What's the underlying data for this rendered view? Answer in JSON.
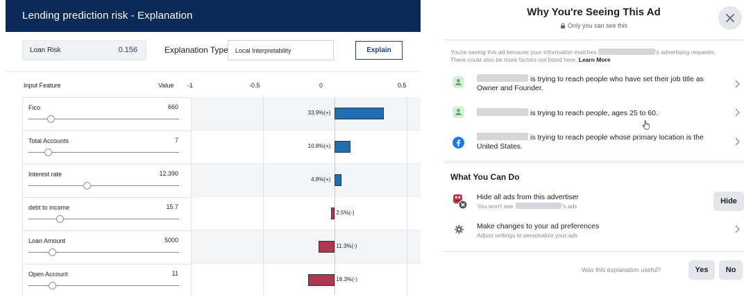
{
  "left_panel": {
    "title": "Lending prediction risk - Explanation",
    "loan_risk_label": "Loan Risk",
    "loan_risk_value": "0.156",
    "explanation_type_label": "Explanation Type",
    "explanation_type_value": "Local Interpretability",
    "explain_button": "Explain",
    "columns": {
      "input_feature": "Input Feature",
      "value": "Value"
    },
    "header_color": "#0b2a57",
    "positive_color": "#1f6fb5",
    "negative_color": "#b0354e",
    "features": [
      {
        "name": "Fico",
        "value": "660",
        "slider_fraction": 0.15
      },
      {
        "name": "Total Accounts",
        "value": "7",
        "slider_fraction": 0.13
      },
      {
        "name": "Interest rate",
        "value": "12.390",
        "slider_fraction": 0.39
      },
      {
        "name": "debt to income",
        "value": "15.7",
        "slider_fraction": 0.21
      },
      {
        "name": "Loan Amount",
        "value": "5000",
        "slider_fraction": 0.16
      },
      {
        "name": "Open Account",
        "value": "11",
        "slider_fraction": 0.16
      }
    ]
  },
  "chart_data": {
    "type": "bar",
    "orientation": "horizontal",
    "categories": [
      "Fico",
      "Total Accounts",
      "Interest rate",
      "debt to income",
      "Loan Amount",
      "Open Account"
    ],
    "values": [
      0.339,
      0.108,
      0.048,
      -0.025,
      -0.113,
      -0.183
    ],
    "data_labels": [
      "33.9%(+)",
      "10.8%(+)",
      "4.8%(+)",
      "2.5%(-)",
      "11.3%(-)",
      "18.3%(-)"
    ],
    "xlim": [
      -1,
      0.5
    ],
    "x_ticks": [
      "-1",
      "-0.5",
      "0",
      "0.5"
    ],
    "grid": true
  },
  "right_panel": {
    "title": "Why You're Seeing This Ad",
    "subtitle": "Only you can see this",
    "intro_prefix": "You're seeing this ad because your information matches",
    "intro_middle": "'s advertising requests. There could also be more factors not listed here.",
    "learn_more": "Learn More",
    "reasons": [
      {
        "icon": "person-icon",
        "text": "is trying to reach people who have set their job title as Owner and Founder."
      },
      {
        "icon": "person-icon",
        "text": "is trying to reach people, ages 25 to 60."
      },
      {
        "icon": "facebook-icon",
        "text": "is trying to reach people whose primary location is the United States."
      }
    ],
    "what_you_can_do": "What You Can Do",
    "hide_title": "Hide all ads from this advertiser",
    "hide_sub_prefix": "You won't see",
    "hide_sub_suffix": "'s ads",
    "hide_button": "Hide",
    "prefs_title": "Make changes to your ad preferences",
    "prefs_sub": "Adjust settings to personalize your ads",
    "useful_question": "Was this explanation useful?",
    "yes_button": "Yes",
    "no_button": "No"
  }
}
